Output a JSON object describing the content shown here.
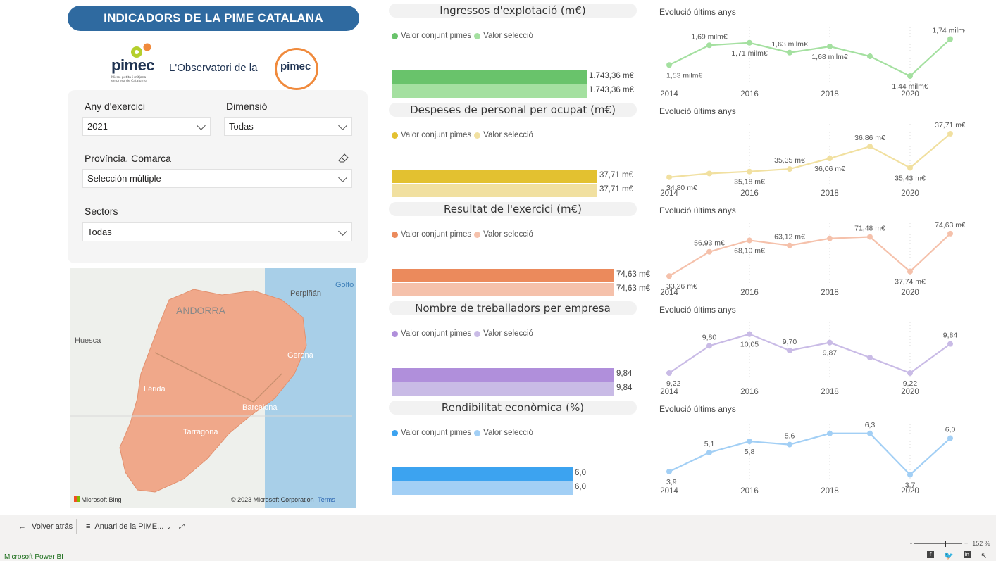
{
  "header": {
    "title": "INDICADORS DE LA PIME CATALANA"
  },
  "logo": {
    "pimec": "pimec",
    "pimec_sub": "Micro, petita i mitjana empresa de Catalunya",
    "observatori": "L'Observatori de la",
    "observatori_pimec": "pimec"
  },
  "filters": {
    "year_label": "Any d'exercici",
    "year_value": "2021",
    "dimension_label": "Dimensió",
    "dimension_value": "Todas",
    "province_label": "Província, Comarca",
    "province_value": "Selección múltiple",
    "sectors_label": "Sectors",
    "sectors_value": "Todas"
  },
  "map": {
    "labels": [
      "Perpiñán",
      "Golfo",
      "ANDORRA",
      "Huesca",
      "Gerona",
      "Lérida",
      "Barcelona",
      "Tarragona"
    ],
    "bing": "Microsoft Bing",
    "copyright": "© 2023 Microsoft Corporation",
    "terms": "Terms",
    "land_color": "#f0a88a"
  },
  "legend": {
    "total": "Valor conjunt pimes",
    "selection": "Valor selecció"
  },
  "sections": [
    {
      "title": "Ingressos d'explotació (m€)",
      "total": "1.743,36 m€",
      "selection": "1.743,36 m€",
      "color_dark": "#69c36b",
      "color_light": "#a4e0a0"
    },
    {
      "title": "Despeses de personal per ocupat (m€)",
      "total": "37,71 m€",
      "selection": "37,71 m€",
      "color_dark": "#e3c130",
      "color_light": "#f1e0a0"
    },
    {
      "title": "Resultat de l'exercici (m€)",
      "total": "74,63 m€",
      "selection": "74,63 m€",
      "color_dark": "#eb8a5c",
      "color_light": "#f5c1ab"
    },
    {
      "title": "Nombre de treballadors per empresa",
      "total": "9,84",
      "selection": "9,84",
      "color_dark": "#b08fdb",
      "color_light": "#c9bbe6"
    },
    {
      "title": "Rendibilitat econòmica (%)",
      "total": "6,0",
      "selection": "6,0",
      "color_dark": "#3ca3f0",
      "color_light": "#a2cff5"
    }
  ],
  "evolution_title": "Evolució últims anys",
  "chart_data": [
    {
      "type": "line",
      "x": [
        2014,
        2015,
        2016,
        2017,
        2018,
        2019,
        2020,
        2021
      ],
      "values": [
        1.53,
        1.69,
        1.71,
        1.63,
        1.68,
        1.6,
        1.44,
        1.74
      ],
      "labels": [
        "1,53 milm€",
        "1,69 milm€",
        "1,71 milm€",
        "1,63 milm€",
        "1,68 milm€",
        "",
        "1,44 milm€",
        "1,74 milm€"
      ],
      "ylim": [
        1.4,
        1.8
      ],
      "xticks": [
        "2014",
        "2016",
        "2018",
        "2020"
      ],
      "color": "#a4e0a0"
    },
    {
      "type": "line",
      "x": [
        2014,
        2015,
        2016,
        2017,
        2018,
        2019,
        2020,
        2021
      ],
      "values": [
        34.8,
        35.05,
        35.18,
        35.35,
        36.06,
        36.86,
        35.43,
        37.71
      ],
      "labels": [
        "34,80 m€",
        "",
        "35,18 m€",
        "35,35 m€",
        "36,06 m€",
        "36,86 m€",
        "35,43 m€",
        "37,71 m€"
      ],
      "ylim": [
        34.6,
        37.9
      ],
      "xticks": [
        "2014",
        "2016",
        "2018",
        "2020"
      ],
      "color": "#f1e0a0"
    },
    {
      "type": "line",
      "x": [
        2014,
        2015,
        2016,
        2017,
        2018,
        2019,
        2020,
        2021
      ],
      "values": [
        33.26,
        56.93,
        68.1,
        63.12,
        70.0,
        71.48,
        37.74,
        74.63
      ],
      "labels": [
        "33,26 m€",
        "56,93 m€",
        "68,10 m€",
        "63,12 m€",
        "",
        "71,48 m€",
        "37,74 m€",
        "74,63 m€"
      ],
      "ylim": [
        30,
        78
      ],
      "xticks": [
        "2014",
        "2016",
        "2018",
        "2020"
      ],
      "color": "#f5c1ab"
    },
    {
      "type": "line",
      "x": [
        2014,
        2015,
        2016,
        2017,
        2018,
        2019,
        2020,
        2021
      ],
      "values": [
        9.22,
        9.8,
        10.05,
        9.7,
        9.87,
        9.55,
        9.22,
        9.84
      ],
      "labels": [
        "9,22",
        "9,80",
        "10,05",
        "9,70",
        "9,87",
        "",
        "9,22",
        "9,84"
      ],
      "ylim": [
        9.1,
        10.15
      ],
      "xticks": [
        "2014",
        "2016",
        "2018",
        "2020"
      ],
      "color": "#c9bbe6"
    },
    {
      "type": "line",
      "x": [
        2014,
        2015,
        2016,
        2017,
        2018,
        2019,
        2020,
        2021
      ],
      "values": [
        3.9,
        5.1,
        5.8,
        5.6,
        6.3,
        6.3,
        3.7,
        6.0
      ],
      "labels": [
        "3,9",
        "5,1",
        "5,8",
        "5,6",
        "",
        "6,3",
        "3,7",
        "6,0"
      ],
      "ylim": [
        3.5,
        6.6
      ],
      "xticks": [
        "2014",
        "2016",
        "2018",
        "2020"
      ],
      "color": "#a2cff5"
    }
  ],
  "footer": {
    "back": "Volver atrás",
    "report": "Anuari de la PIME...",
    "zoom": "152 %",
    "powerbi": "Microsoft Power BI"
  }
}
